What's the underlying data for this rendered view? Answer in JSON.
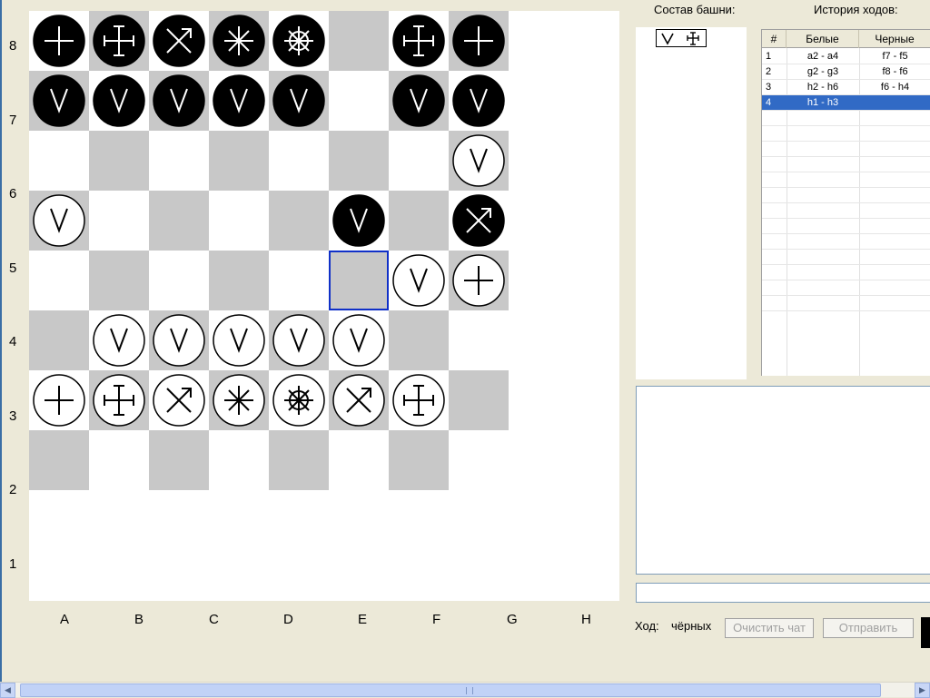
{
  "board": {
    "files": [
      "A",
      "B",
      "C",
      "D",
      "E",
      "F",
      "G",
      "H"
    ],
    "ranks": [
      "8",
      "7",
      "6",
      "5",
      "4",
      "3",
      "2",
      "1"
    ],
    "light_color": "#ffffff",
    "dark_color": "#c8c8c8",
    "selected_square": "f4",
    "pieces": [
      {
        "square": "a8",
        "color": "black",
        "icon": "plus-icon"
      },
      {
        "square": "b8",
        "color": "black",
        "icon": "double-cross-icon"
      },
      {
        "square": "c8",
        "color": "black",
        "icon": "arrow-cross-icon"
      },
      {
        "square": "d8",
        "color": "black",
        "icon": "asterisk-icon"
      },
      {
        "square": "e8",
        "color": "black",
        "icon": "wheel-icon"
      },
      {
        "square": "g8",
        "color": "black",
        "icon": "double-cross-icon"
      },
      {
        "square": "h8",
        "color": "black",
        "icon": "plus-icon"
      },
      {
        "square": "a7",
        "color": "black",
        "icon": "v-icon"
      },
      {
        "square": "b7",
        "color": "black",
        "icon": "v-icon"
      },
      {
        "square": "c7",
        "color": "black",
        "icon": "v-icon"
      },
      {
        "square": "d7",
        "color": "black",
        "icon": "v-icon"
      },
      {
        "square": "e7",
        "color": "black",
        "icon": "v-icon"
      },
      {
        "square": "g7",
        "color": "black",
        "icon": "v-icon"
      },
      {
        "square": "h7",
        "color": "black",
        "icon": "v-icon"
      },
      {
        "square": "h6",
        "color": "white",
        "icon": "v-icon"
      },
      {
        "square": "f5",
        "color": "black",
        "icon": "v-icon"
      },
      {
        "square": "a5",
        "color": "white",
        "icon": "v-icon"
      },
      {
        "square": "h5",
        "color": "black",
        "icon": "arrow-cross-icon"
      },
      {
        "square": "g4",
        "color": "white",
        "icon": "v-icon"
      },
      {
        "square": "h4",
        "color": "white",
        "icon": "plus-icon"
      },
      {
        "square": "b3",
        "color": "white",
        "icon": "v-icon"
      },
      {
        "square": "c3",
        "color": "white",
        "icon": "v-icon"
      },
      {
        "square": "d3",
        "color": "white",
        "icon": "v-icon"
      },
      {
        "square": "e3",
        "color": "white",
        "icon": "v-icon"
      },
      {
        "square": "f3",
        "color": "white",
        "icon": "v-icon"
      },
      {
        "square": "a2",
        "color": "white",
        "icon": "plus-icon"
      },
      {
        "square": "b2",
        "color": "white",
        "icon": "double-cross-icon"
      },
      {
        "square": "c2",
        "color": "white",
        "icon": "arrow-cross-icon"
      },
      {
        "square": "d2",
        "color": "white",
        "icon": "asterisk-icon"
      },
      {
        "square": "e2",
        "color": "white",
        "icon": "wheel-icon"
      },
      {
        "square": "f2",
        "color": "white",
        "icon": "arrow-cross-icon"
      },
      {
        "square": "g2",
        "color": "white",
        "icon": "double-cross-icon"
      }
    ]
  },
  "tower": {
    "label": "Состав башни:",
    "pieces": [
      "v-icon",
      "double-cross-icon"
    ]
  },
  "history": {
    "label": "История ходов:",
    "columns": [
      "#",
      "Белые",
      "Черные"
    ],
    "rows": [
      {
        "num": "1",
        "white": "a2 - a4",
        "black": "f7 - f5"
      },
      {
        "num": "2",
        "white": "g2 - g3",
        "black": "f8 - f6"
      },
      {
        "num": "3",
        "white": "h2 - h6",
        "black": "f6 - h4"
      },
      {
        "num": "4",
        "white": "h1 - h3",
        "black": ""
      }
    ],
    "selected_row": 3,
    "selection_color": "#316ac5"
  },
  "turn": {
    "label": "Ход:",
    "value": "чёрных"
  },
  "buttons": {
    "clear_chat": "Очистить чат",
    "send": "Отправить"
  }
}
